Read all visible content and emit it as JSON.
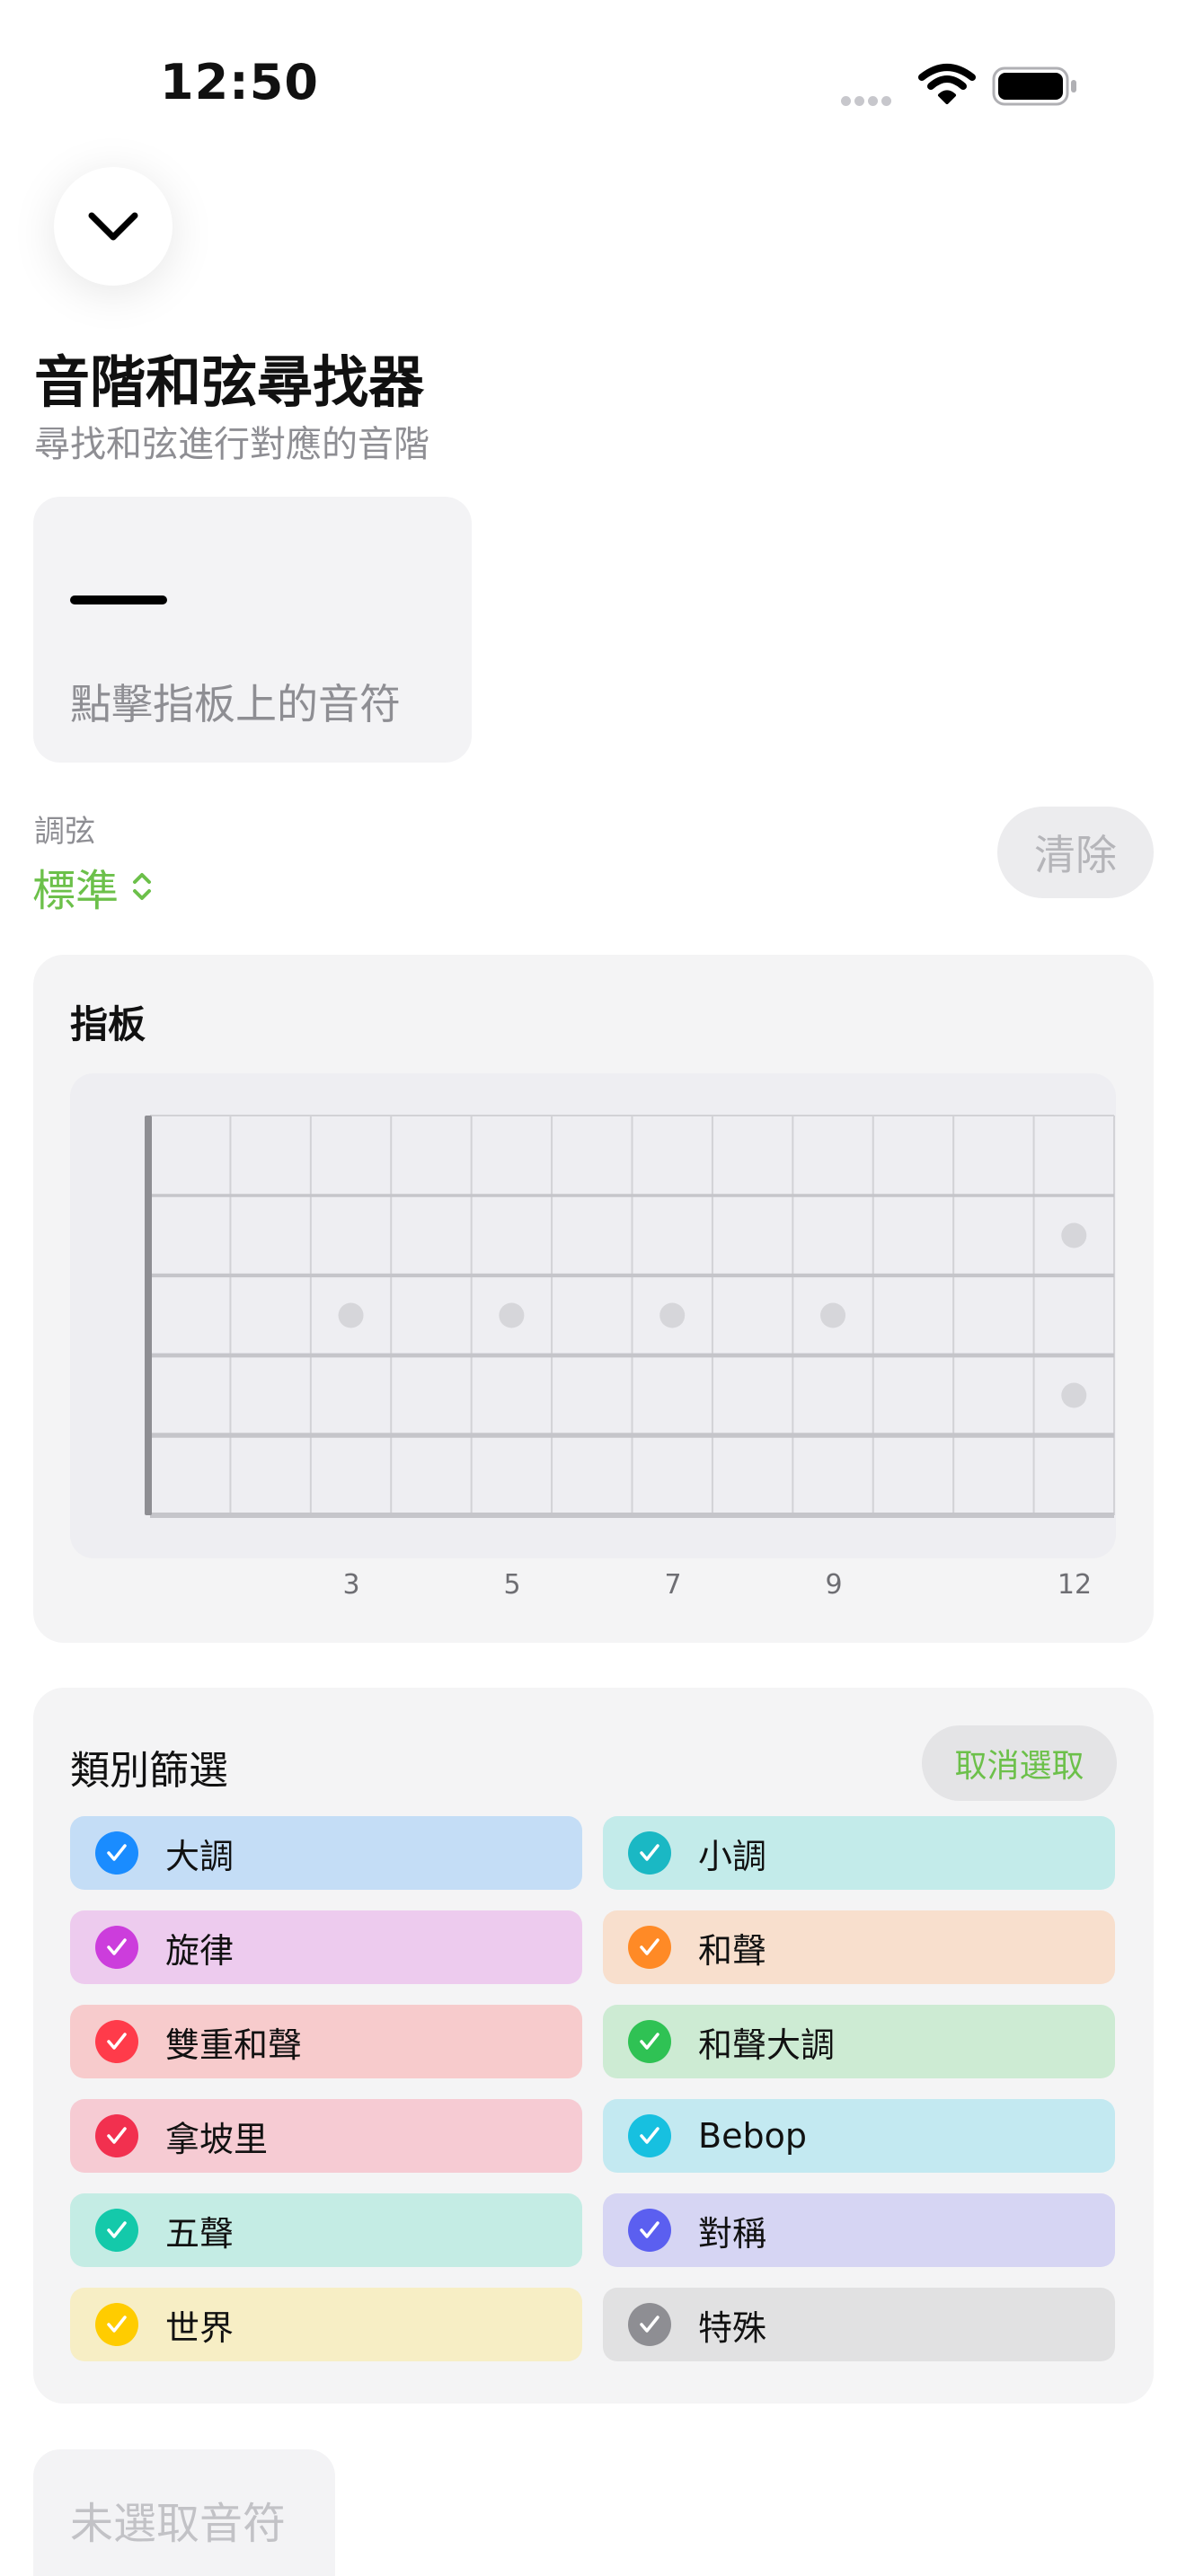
{
  "status_bar": {
    "time": "12:50"
  },
  "header": {
    "title": "音階和弦尋找器",
    "subtitle": "尋找和弦進行對應的音階"
  },
  "notes_card": {
    "hint": "點擊指板上的音符"
  },
  "tuning": {
    "label": "調弦",
    "value": "標準"
  },
  "clear_button": "清除",
  "fretboard": {
    "title": "指板",
    "fret_markers": [
      "3",
      "5",
      "7",
      "9",
      "12"
    ]
  },
  "filter": {
    "title": "類別篩選",
    "deselect_label": "取消選取",
    "categories": [
      {
        "label": "大調",
        "color": "#1a8cff",
        "bg": "#c4ddf6",
        "checked": true
      },
      {
        "label": "小調",
        "color": "#1ab8c4",
        "bg": "#c3ebea",
        "checked": true
      },
      {
        "label": "旋律",
        "color": "#cc3ddc",
        "bg": "#edcbee",
        "checked": true
      },
      {
        "label": "和聲",
        "color": "#ff8a26",
        "bg": "#f8dfcd",
        "checked": true
      },
      {
        "label": "雙重和聲",
        "color": "#ff3b4a",
        "bg": "#f7cbcc",
        "checked": true
      },
      {
        "label": "和聲大調",
        "color": "#2fc254",
        "bg": "#cdebd3",
        "checked": true
      },
      {
        "label": "拿坡里",
        "color": "#f2304f",
        "bg": "#f6cbd3",
        "checked": true
      },
      {
        "label": "Bebop",
        "color": "#17c0e0",
        "bg": "#c3e9f1",
        "checked": true
      },
      {
        "label": "五聲",
        "color": "#14c9aa",
        "bg": "#c4ece4",
        "checked": true
      },
      {
        "label": "對稱",
        "color": "#5b5ff0",
        "bg": "#d6d5f3",
        "checked": true
      },
      {
        "label": "世界",
        "color": "#ffcc00",
        "bg": "#f7eec5",
        "checked": true
      },
      {
        "label": "特殊",
        "color": "#8e8e93",
        "bg": "#e1e1e2",
        "checked": true
      }
    ]
  },
  "no_notes_label": "未選取音符"
}
